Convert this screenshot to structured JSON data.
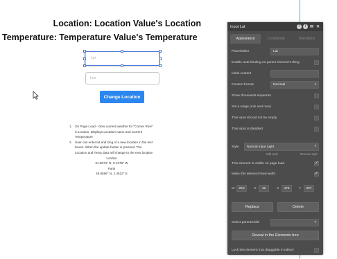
{
  "canvas": {
    "location_line": "Location: Location Value's Location",
    "temperature_line": "Temperature:  Temperature Value's Temperature",
    "lat_input": {
      "placeholder": "Lat"
    },
    "lon_input": {
      "placeholder": "Lon"
    },
    "change_button": "Change Location",
    "instructions": {
      "item1_num": "1.",
      "item1_text": "On Page Load - Gets current weather for \"Corner Row\" in London. Displays Location name and Current Temperature",
      "item2_num": "2.",
      "item2_text": "User can enter lat and long of a new location in the text boxes. When the update button is pressed. The Location and Temp data will change to the new location",
      "examples": [
        "London",
        "51.5074° N, 0.1278° W",
        "Paris",
        "48.8566° N, 2.3522° E"
      ]
    }
  },
  "panel": {
    "title": "Input Lat",
    "header_icons": [
      "help-icon",
      "info-icon",
      "comment-icon",
      "close-icon"
    ],
    "tabs": [
      {
        "label": "Appearance",
        "active": true
      },
      {
        "label": "Conditional",
        "active": false
      },
      {
        "label": "Transitions",
        "active": false
      }
    ],
    "placeholder_label": "Placeholder",
    "placeholder_value": "Lat",
    "autobind_label": "Enable auto-binding on parent element's thing",
    "initial_content_label": "Initial content",
    "initial_content_value": "",
    "content_format_label": "Content format",
    "content_format_value": "Decimal",
    "thousands_label": "Show thousands separator",
    "range_label": "Set a range (min and max)",
    "not_empty_label": "This input should not be empty",
    "disabled_label": "This input is disabled",
    "style_label": "Style",
    "style_value": "Normal Input Light",
    "edit_style": "Edit style",
    "remove_style": "Remove style",
    "visible_label": "This element is visible on page load",
    "visible_checked": true,
    "fixed_width_label": "Make this element fixed-width",
    "fixed_width_checked": true,
    "geometry": [
      {
        "label": "W",
        "value": "250"
      },
      {
        "label": "H",
        "value": "45"
      },
      {
        "label": "X",
        "value": "475"
      },
      {
        "label": "Y",
        "value": "267"
      }
    ],
    "replace_button": "Replace",
    "delete_button": "Delete",
    "select_parent_label": "Select parent/child",
    "reveal_button": "Reveal in the Elements tree",
    "lock_label": "Lock this element (not draggable in editor)",
    "colors": {
      "panel_bg": "#4c4c4c",
      "header_bg": "#3c3c3c",
      "button_blue": "#2b86f0",
      "selection": "#4a7bd8"
    }
  }
}
